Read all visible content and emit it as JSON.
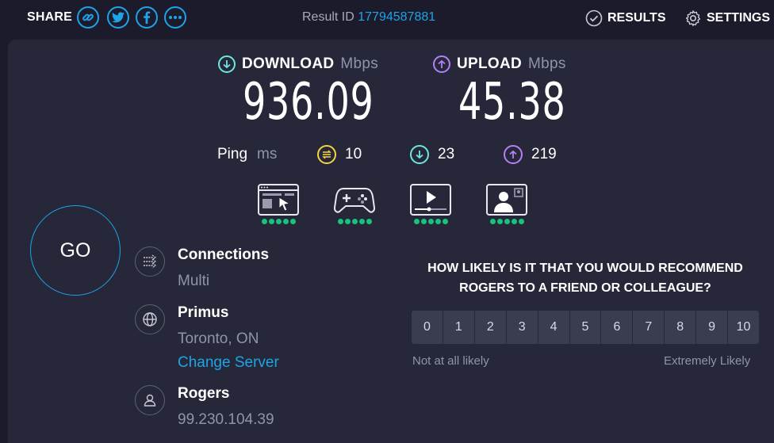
{
  "topbar": {
    "share_label": "SHARE",
    "share_icons": [
      "link-icon",
      "twitter-icon",
      "facebook-icon",
      "more-icon"
    ],
    "result_id_label": "Result ID",
    "result_id_value": "17794587881",
    "results_label": "RESULTS",
    "settings_label": "SETTINGS"
  },
  "download": {
    "label": "DOWNLOAD",
    "unit": "Mbps",
    "value": "936.09"
  },
  "upload": {
    "label": "UPLOAD",
    "unit": "Mbps",
    "value": "45.38"
  },
  "ping": {
    "label": "Ping",
    "unit": "ms",
    "idle": "10",
    "download": "23",
    "upload": "219"
  },
  "usecases": [
    {
      "icon": "web-browsing-icon",
      "rating": 5
    },
    {
      "icon": "gaming-icon",
      "rating": 5
    },
    {
      "icon": "streaming-icon",
      "rating": 5
    },
    {
      "icon": "video-call-icon",
      "rating": 5
    }
  ],
  "go_label": "GO",
  "connections": {
    "title": "Connections",
    "value": "Multi"
  },
  "server": {
    "name": "Primus",
    "location": "Toronto, ON",
    "change_label": "Change Server"
  },
  "provider": {
    "name": "Rogers",
    "ip": "99.230.104.39"
  },
  "survey": {
    "question": "HOW LIKELY IS IT THAT YOU WOULD RECOMMEND ROGERS TO A FRIEND OR COLLEAGUE?",
    "scale": [
      "0",
      "1",
      "2",
      "3",
      "4",
      "5",
      "6",
      "7",
      "8",
      "9",
      "10"
    ],
    "low_label": "Not at all likely",
    "high_label": "Extremely Likely"
  },
  "colors": {
    "accent": "#1fa3e8",
    "download": "#6fe6e0",
    "upload": "#b67ff7",
    "ping_idle": "#f5d442",
    "rating_dot": "#18c37e"
  }
}
